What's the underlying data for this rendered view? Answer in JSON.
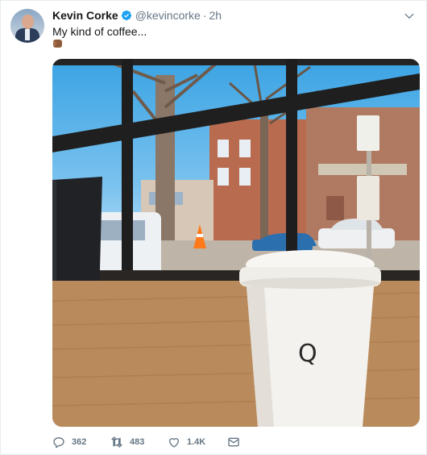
{
  "tweet": {
    "author_name": "Kevin Corke",
    "handle": "@kevincorke",
    "separator": "·",
    "time": "2h",
    "text": "My kind of coffee...",
    "cup_letter": "Q"
  },
  "icons": {
    "avatar": "profile-photo",
    "verified": "verified-badge-icon",
    "menu": "chevron-down-icon",
    "emoji": "coffee-emoji-icon",
    "reply": "reply-icon",
    "retweet": "retweet-icon",
    "like": "heart-icon",
    "dm": "direct-message-icon"
  },
  "actions": {
    "replies": "362",
    "retweets": "483",
    "likes": "1.4K"
  },
  "colors": {
    "verified": "#1da1f2",
    "secondary_text": "#657786"
  }
}
